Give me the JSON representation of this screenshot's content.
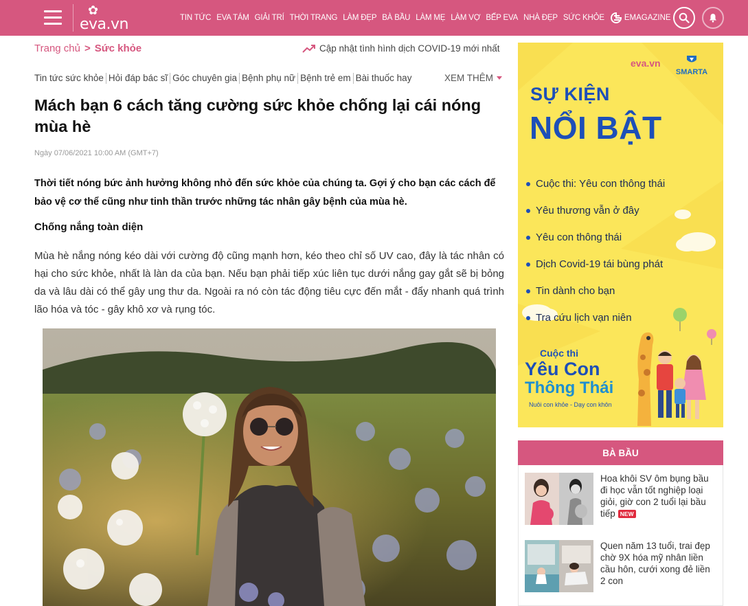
{
  "header": {
    "logo_text": "eva.vn",
    "nav": [
      "TIN TỨC",
      "EVA TÁM",
      "GIẢI TRÍ",
      "THỜI TRANG",
      "LÀM ĐẸP",
      "BÀ BẦU",
      "LÀM MẸ",
      "LÀM VỢ",
      "BẾP EVA",
      "NHÀ ĐẸP",
      "SỨC KHỎE"
    ],
    "emagazine": "EMAGAZINE",
    "icons": {
      "menu": "hamburger-icon",
      "search": "search-icon",
      "notifications": "bell-icon"
    },
    "bg_color": "#d6577f"
  },
  "breadcrumb": {
    "home": "Trang chủ",
    "separator": ">",
    "current": "Sức khỏe"
  },
  "covid_link": "Cập nhật tình hình dịch COVID-19 mới nhất",
  "subnav": {
    "items": [
      "Tin tức sức khỏe",
      "Hỏi đáp bác sĩ",
      "Góc chuyên gia",
      "Bệnh phụ nữ",
      "Bệnh trẻ em",
      "Bài thuốc hay"
    ],
    "more": "XEM THÊM"
  },
  "article": {
    "title": "Mách bạn 6 cách tăng cường sức khỏe chống lại cái nóng mùa hè",
    "date": "Ngày 07/06/2021 10:00 AM (GMT+7)",
    "lead": "Thời tiết nóng bức ảnh hưởng không nhỏ đến sức khỏe của chúng ta. Gợi ý cho bạn các cách để bảo vệ cơ thể cũng như tinh thần trước những tác nhân gây bệnh của mùa hè.",
    "subhead": "Chống nắng toàn diện",
    "paragraph": "Mùa hè nắng nóng kéo dài với cường độ cũng mạnh hơn, kéo theo chỉ số UV cao, đây là tác nhân có hại cho sức khỏe, nhất là làn da của bạn. Nếu bạn phải tiếp xúc liên tục dưới nắng gay gắt sẽ bị bỏng da và lâu dài có thể gây ung thư da. Ngoài ra nó còn tác động tiêu cực đến mắt - đẩy nhanh quá trình lão hóa và tóc - gây khô xơ và rụng tóc."
  },
  "banner": {
    "brand_eva": "eva.vn",
    "brand_smarta": "SMARTA",
    "title_line1": "SỰ KIỆN",
    "title_line2": "NỔI BẬT",
    "items": [
      "Cuộc thi: Yêu con thông thái",
      "Yêu thương vẫn ở đây",
      "Yêu con thông thái",
      "Dịch Covid-19 tái bùng phát",
      "Tin dành cho bạn",
      "Tra cứu lịch vạn niên"
    ],
    "contest_line1": "Cuộc thi",
    "contest_line2": "Yêu Con",
    "contest_line3": "Thông Thái",
    "contest_tagline": "Nuôi con khỏe - Dạy con khôn"
  },
  "ba_bau": {
    "heading": "BÀ BẦU",
    "items": [
      {
        "title": "Hoa khôi SV ôm bụng bầu đi học vẫn tốt nghiệp loại giỏi, giờ con 2 tuổi lại bầu tiếp",
        "badge": "NEW"
      },
      {
        "title": "Quen năm 13 tuổi, trai đẹp chờ 9X hóa mỹ nhân liền cầu hôn, cưới xong đẻ liền 2 con",
        "badge": ""
      }
    ]
  },
  "colors": {
    "brand_pink": "#d6577f",
    "banner_yellow": "#fbe65a",
    "banner_blue": "#1d4fb8"
  }
}
